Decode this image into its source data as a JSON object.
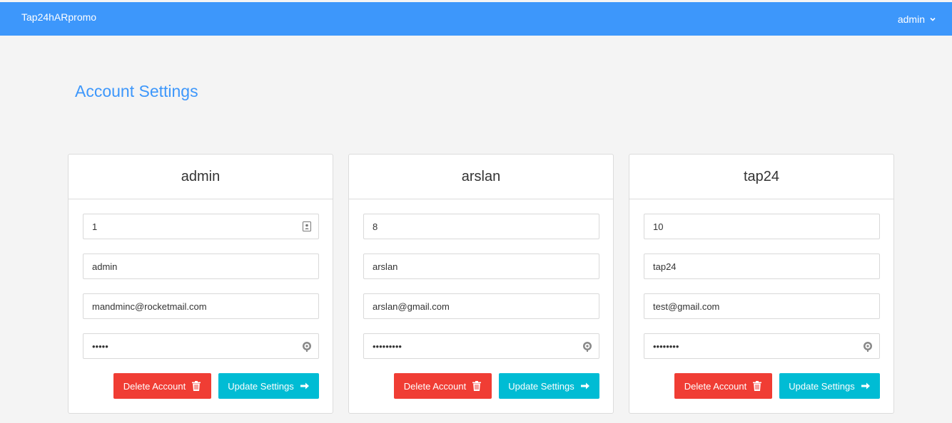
{
  "navbar": {
    "brand": "Tap24hARpromo",
    "user": "admin"
  },
  "page": {
    "title": "Account Settings"
  },
  "accounts": [
    {
      "name": "admin",
      "id": "1",
      "username": "admin",
      "email": "mandminc@rocketmail.com",
      "password": "•••••",
      "delete_label": "Delete Account",
      "update_label": "Update Settings"
    },
    {
      "name": "arslan",
      "id": "8",
      "username": "arslan",
      "email": "arslan@gmail.com",
      "password": "•••••••••",
      "delete_label": "Delete Account",
      "update_label": "Update Settings"
    },
    {
      "name": "tap24",
      "id": "10",
      "username": "tap24",
      "email": "test@gmail.com",
      "password": "••••••••",
      "delete_label": "Delete Account",
      "update_label": "Update Settings"
    }
  ],
  "colors": {
    "navbar": "#3d97fb",
    "title": "#3d97fb",
    "delete": "#f03d34",
    "update": "#00bcd4"
  },
  "icons": {
    "user_menu": "chevron-down-icon",
    "id_field": "contact-card-icon",
    "password_field": "password-reveal-icon",
    "delete": "trash-icon",
    "update": "arrow-right-icon"
  }
}
